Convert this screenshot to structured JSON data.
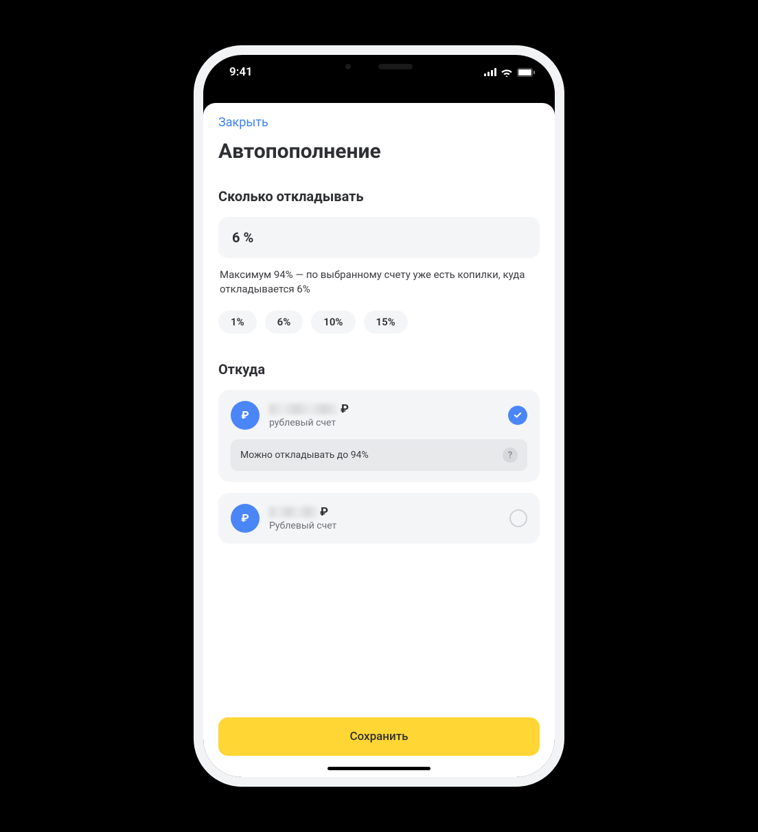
{
  "status": {
    "time": "9:41"
  },
  "sheet": {
    "close_label": "Закрыть",
    "title": "Автопополнение"
  },
  "amount_section": {
    "title": "Сколько откладывать",
    "value": "6 %",
    "hint": "Максимум 94% — по выбранному счету уже есть копилки, куда откладывается 6%",
    "chips": [
      "1%",
      "6%",
      "10%",
      "15%"
    ]
  },
  "source_section": {
    "title": "Откуда",
    "accounts": [
      {
        "currency_symbol": "₽",
        "subtitle": "рублевый счет",
        "selected": true,
        "note": "Можно откладывать до 94%"
      },
      {
        "currency_symbol": "₽",
        "subtitle": "Рублевый счет",
        "selected": false
      }
    ]
  },
  "save_button": "Сохранить"
}
